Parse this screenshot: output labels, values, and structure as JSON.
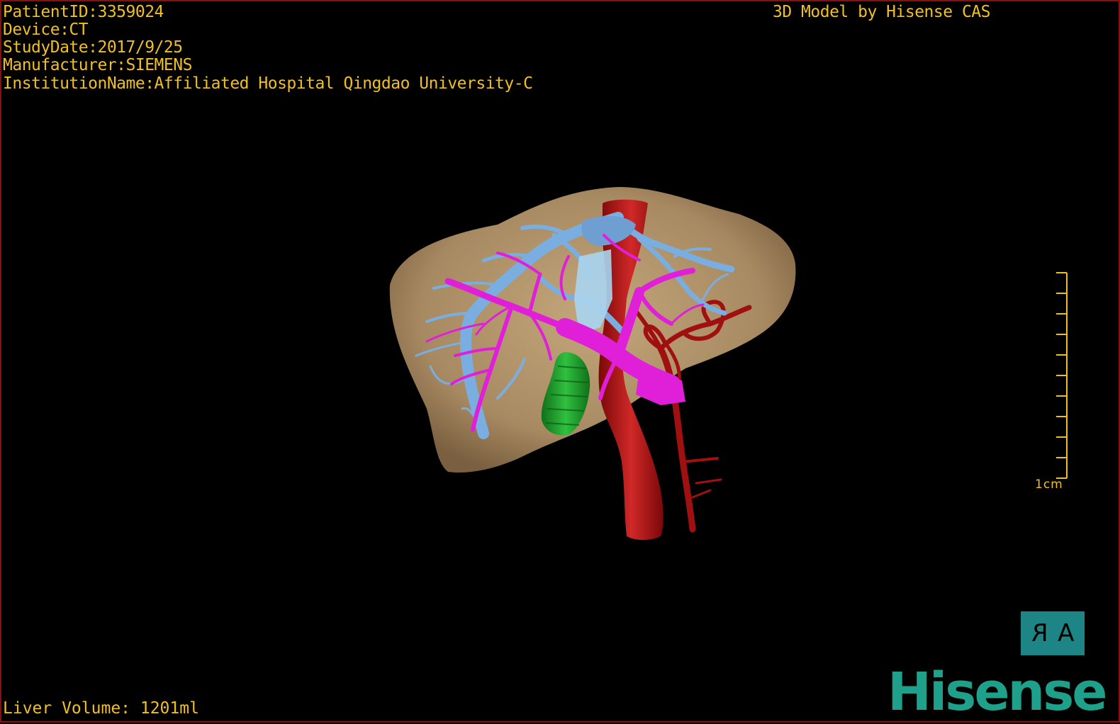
{
  "overlay": {
    "patient_id": "PatientID:3359024",
    "device": "Device:CT",
    "study_date": "StudyDate:2017/9/25",
    "manufacturer": "Manufacturer:SIEMENS",
    "institution": "InstitutionName:Affiliated Hospital Qingdao University-C",
    "header_title": "3D Model by Hisense CAS",
    "liver_volume": "Liver Volume: 1201ml"
  },
  "scale_bar": {
    "label": "1cm"
  },
  "orientation": {
    "left_glyph": "R",
    "right_glyph": "A"
  },
  "brand": {
    "name": "Hisense"
  },
  "colors": {
    "text": "#f0c020",
    "liver": "#b89a72",
    "hepatic_vein": "#7aaee0",
    "portal_vein": "#e020d8",
    "artery": "#b01212",
    "gallbladder": "#20a030",
    "brand": "#1ea08a",
    "orientation_box": "#1d8585",
    "frame_border": "#8a1010"
  }
}
